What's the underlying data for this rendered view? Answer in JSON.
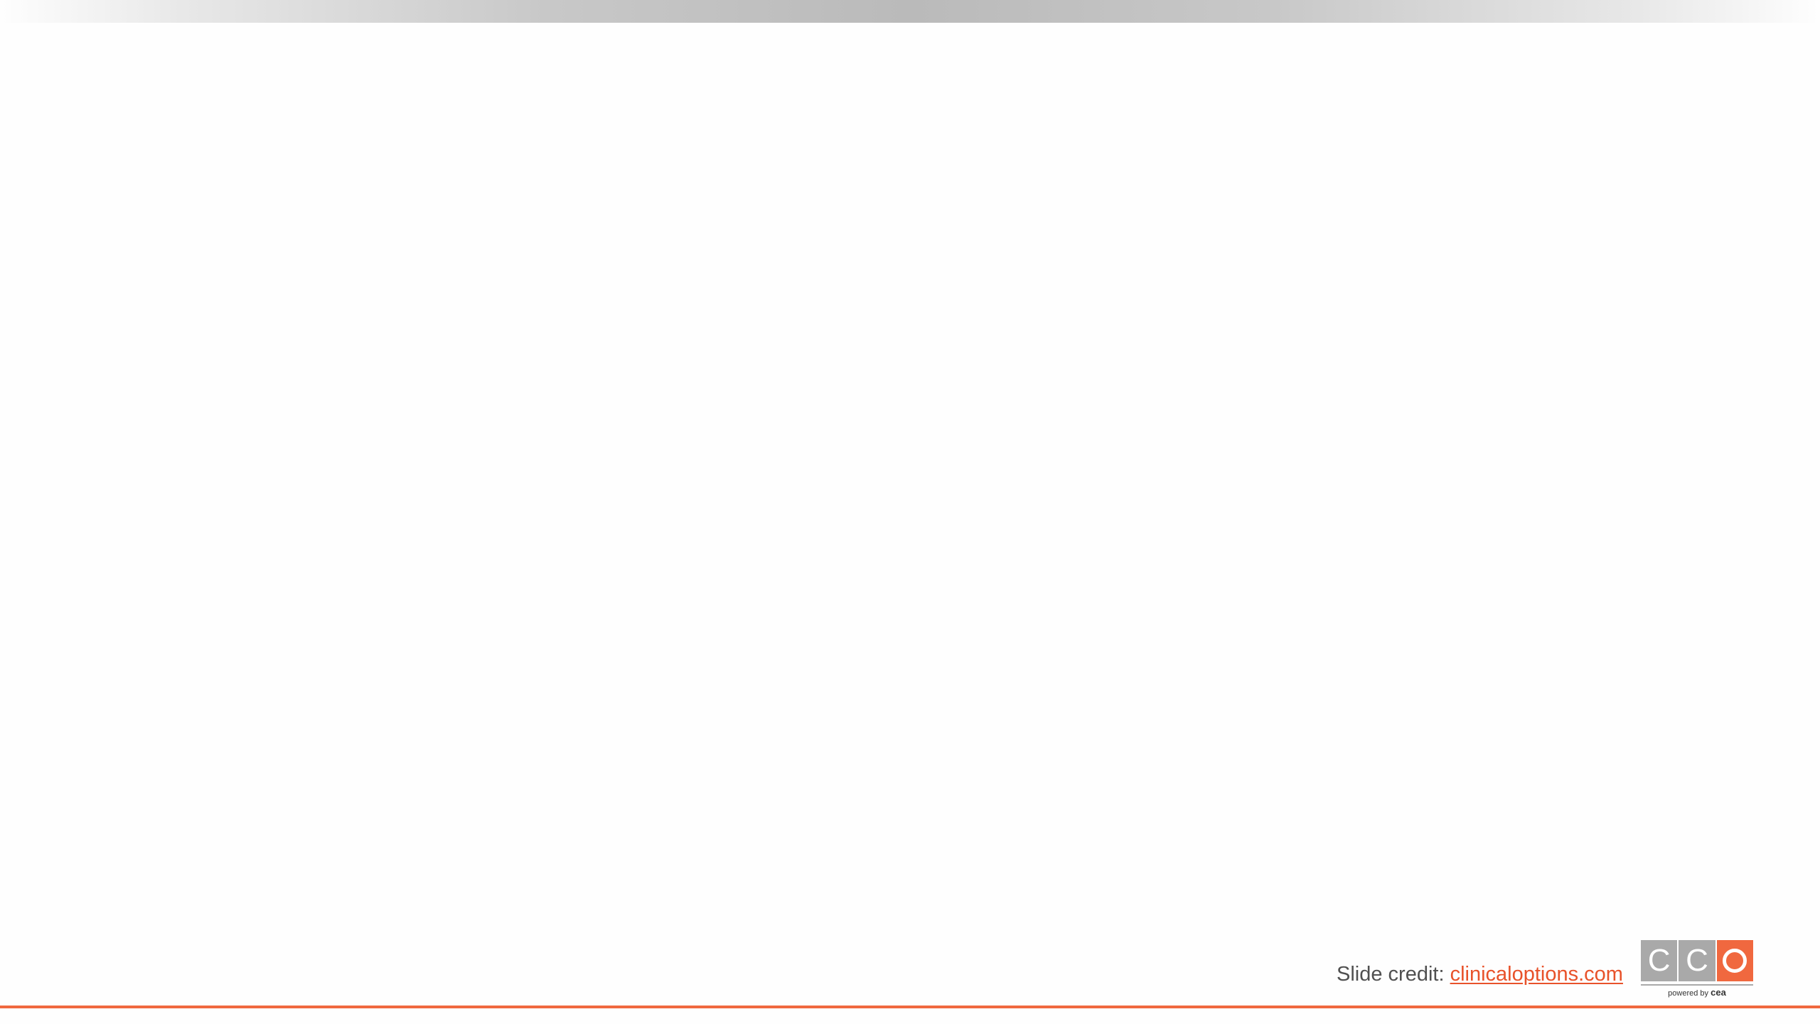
{
  "footer": {
    "credit_prefix": "Slide credit: ",
    "credit_link": "clinicaloptions.com"
  },
  "logo": {
    "tiles": [
      "C",
      "C",
      "O"
    ],
    "powered_by": "powered by",
    "powered_brand": "cea"
  },
  "colors": {
    "accent": "#f0683f",
    "logo_gray": "#a9a9a9",
    "text": "#505050",
    "link": "#e8522a"
  }
}
